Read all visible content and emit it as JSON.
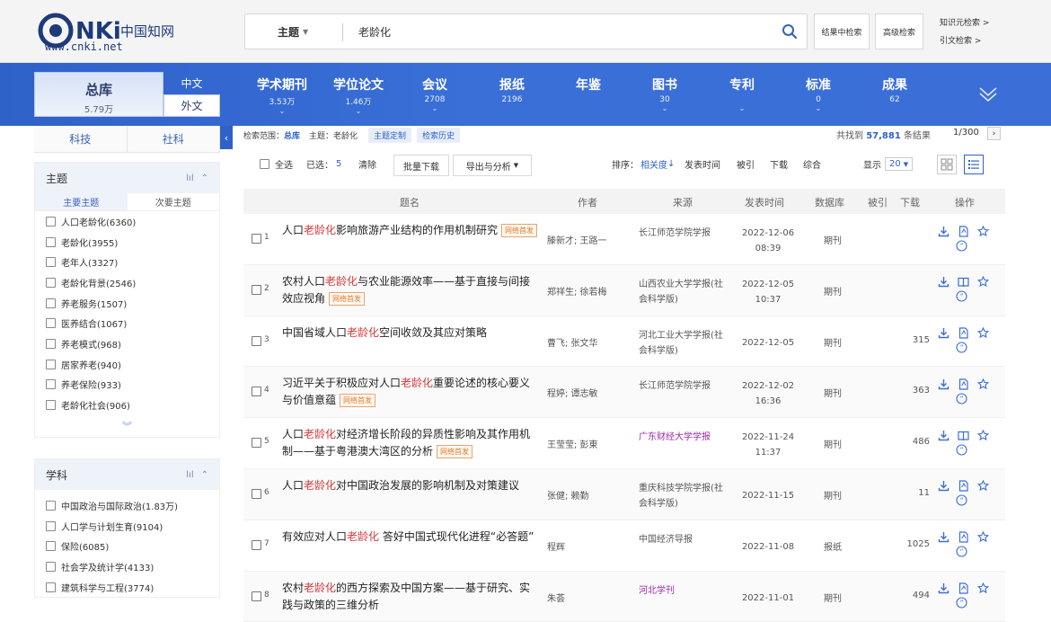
{
  "header": {
    "logo_text": "CNKi中国知网",
    "logo_sub": "www.cnki.net",
    "search_field": "主题",
    "search_value": "老龄化",
    "btn_within": "结果中检索",
    "btn_advanced": "高级检索",
    "link_knowledge": "知识元检索 >",
    "link_citation": "引文检索 >"
  },
  "nav": {
    "zongku_title": "总库",
    "zongku_count": "5.79万",
    "lang_zh": "中文",
    "lang_en": "外文",
    "tabs": [
      {
        "label": "学术期刊",
        "count": "3.53万"
      },
      {
        "label": "学位论文",
        "count": "1.46万"
      },
      {
        "label": "会议",
        "count": "2708"
      },
      {
        "label": "报纸",
        "count": "2196"
      },
      {
        "label": "年鉴",
        "count": ""
      },
      {
        "label": "图书",
        "count": "30"
      },
      {
        "label": "专利",
        "count": ""
      },
      {
        "label": "标准",
        "count": "0"
      },
      {
        "label": "成果",
        "count": "62"
      }
    ]
  },
  "sidebar": {
    "cat_tabs": [
      "科技",
      "社科"
    ],
    "facet_topic": {
      "title": "主题",
      "subtabs": [
        "主要主题",
        "次要主题"
      ],
      "items": [
        "人口老龄化(6360)",
        "老龄化(3955)",
        "老年人(3327)",
        "老龄化背景(2546)",
        "养老服务(1507)",
        "医养结合(1067)",
        "养老模式(968)",
        "居家养老(940)",
        "养老保险(933)",
        "老龄化社会(906)"
      ]
    },
    "facet_subject": {
      "title": "学科",
      "items": [
        "中国政治与国际政治(1.83万)",
        "人口学与计划生育(9104)",
        "保险(6085)",
        "社会学及统计学(4133)",
        "建筑科学与工程(3774)"
      ]
    }
  },
  "main": {
    "range": {
      "prefix": "检索范围：",
      "db": "总库",
      "topic": "主题：老龄化",
      "chip_custom": "主题定制",
      "chip_history": "检索历史"
    },
    "found_prefix": "共找到",
    "found_count": "57,881",
    "found_suffix": "条结果",
    "page_indicator": "1/300",
    "toolbar": {
      "select_all": "全选",
      "selected_label": "已选：",
      "selected_count": "5",
      "clear": "清除",
      "batch_download": "批量下载",
      "export": "导出与分析",
      "sort_label": "排序：",
      "sort_relevance": "相关度",
      "sort_date": "发表时间",
      "sort_cite": "被引",
      "sort_download": "下载",
      "sort_综合": "综合",
      "display_label": "显示",
      "page_size": "20"
    },
    "columns": {
      "title": "题名",
      "author": "作者",
      "source": "来源",
      "date": "发表时间",
      "db": "数据库",
      "cite": "被引",
      "download": "下载",
      "ops": "操作"
    },
    "rows": [
      {
        "no": "1",
        "pre": "人口",
        "hit": "老龄化",
        "post": "影响旅游产业结构的作用机制研究",
        "tag": "网络首发",
        "author": "滕新才; 王路一",
        "source": "长江师范学院学报",
        "source_link": false,
        "date1": "2022-12-06",
        "date2": "08:39",
        "db": "期刊",
        "cite": "",
        "ops2": "pdf"
      },
      {
        "no": "2",
        "pre": "农村人口",
        "hit": "老龄化",
        "post": "与农业能源效率——基于直接与间接效应视角",
        "tag": "网络首发",
        "author": "郑祥生; 徐若梅",
        "source": "山西农业大学学报(社会科学版)",
        "source_link": false,
        "date1": "2022-12-05",
        "date2": "10:37",
        "db": "期刊",
        "cite": "",
        "ops2": "book"
      },
      {
        "no": "3",
        "pre": "中国省域人口",
        "hit": "老龄化",
        "post": "空间收敛及其应对策略",
        "tag": "",
        "author": "曹飞; 张文华",
        "source": "河北工业大学学报(社会科学版)",
        "source_link": false,
        "date1": "2022-12-05",
        "date2": "",
        "db": "期刊",
        "cite": "315",
        "ops2": "pdf"
      },
      {
        "no": "4",
        "pre": "习近平关于积极应对人口",
        "hit": "老龄化",
        "post": "重要论述的核心要义与价值意蕴",
        "tag": "网络首发",
        "author": "程婷; 谭志敏",
        "source": "长江师范学院学报",
        "source_link": false,
        "date1": "2022-12-02",
        "date2": "16:36",
        "db": "期刊",
        "cite": "363",
        "ops2": "pdf"
      },
      {
        "no": "5",
        "pre": "人口",
        "hit": "老龄化",
        "post": "对经济增长阶段的异质性影响及其作用机制——基于粤港澳大湾区的分析",
        "tag": "网络首发",
        "author": "王莹莹; 彭東",
        "source": "广东财经大学学报",
        "source_link": true,
        "date1": "2022-11-24",
        "date2": "11:37",
        "db": "期刊",
        "cite": "486",
        "ops2": "book"
      },
      {
        "no": "6",
        "pre": "人口",
        "hit": "老龄化",
        "post": "对中国政治发展的影响机制及对策建议",
        "tag": "",
        "author": "张健; 赖勤",
        "source": "重庆科技学院学报(社会科学版)",
        "source_link": false,
        "date1": "2022-11-15",
        "date2": "",
        "db": "期刊",
        "cite": "11",
        "ops2": "pdf"
      },
      {
        "no": "7",
        "pre": "有效应对人口",
        "hit": "老龄化",
        "post": " 答好中国式现代化进程“必答题”",
        "tag": "",
        "author": "程辉",
        "source": "中国经济导报",
        "source_link": false,
        "date1": "2022-11-08",
        "date2": "",
        "db": "报纸",
        "cite": "1025",
        "ops2": "pdf"
      },
      {
        "no": "8",
        "pre": "农村",
        "hit": "老龄化",
        "post": "的西方探索及中国方案——基于研究、实践与政策的三维分析",
        "tag": "",
        "author": "朱荟",
        "source": "河北学刊",
        "source_link": true,
        "date1": "2022-11-01",
        "date2": "",
        "db": "期刊",
        "cite": "494",
        "ops2": "pdf"
      }
    ]
  }
}
